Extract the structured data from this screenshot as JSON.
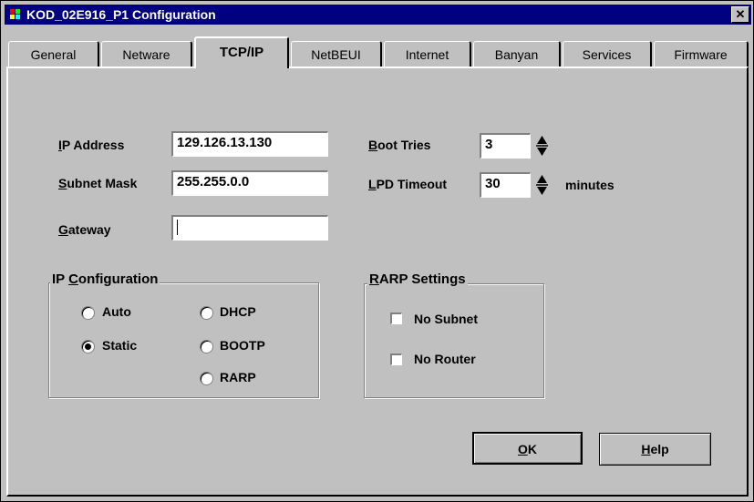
{
  "window": {
    "title": "KOD_02E916_P1 Configuration",
    "close_glyph": "✕"
  },
  "tabs": [
    {
      "label": "General"
    },
    {
      "label": "Netware"
    },
    {
      "label": "TCP/IP",
      "active": true
    },
    {
      "label": "NetBEUI"
    },
    {
      "label": "Internet"
    },
    {
      "label": "Banyan"
    },
    {
      "label": "Services"
    },
    {
      "label": "Firmware"
    }
  ],
  "fields": {
    "ip_address": {
      "label_mn": "I",
      "label_rest": "P Address",
      "value": "129.126.13.130"
    },
    "subnet_mask": {
      "label_mn": "S",
      "label_rest": "ubnet Mask",
      "value": "255.255.0.0"
    },
    "gateway": {
      "label_mn": "G",
      "label_rest": "ateway",
      "value": ""
    },
    "boot_tries": {
      "label_mn": "B",
      "label_rest": "oot Tries",
      "value": "3"
    },
    "lpd_timeout": {
      "label_mn": "L",
      "label_rest": "PD Timeout",
      "value": "30",
      "unit": "minutes"
    }
  },
  "ip_configuration": {
    "legend_pre": "IP ",
    "legend_mn": "C",
    "legend_rest": "onfiguration",
    "options": [
      "Auto",
      "Static",
      "DHCP",
      "BOOTP",
      "RARP"
    ],
    "selected": "Static"
  },
  "rarp_settings": {
    "legend_mn": "R",
    "legend_rest": "ARP Settings",
    "no_subnet": {
      "label": "No Subnet",
      "checked": false
    },
    "no_router": {
      "label": "No Router",
      "checked": false
    }
  },
  "buttons": {
    "ok": {
      "mn": "O",
      "rest": "K"
    },
    "help": {
      "mn": "H",
      "rest": "elp"
    }
  },
  "colors": {
    "titlebar": "#000080",
    "face": "#c0c0c0"
  }
}
